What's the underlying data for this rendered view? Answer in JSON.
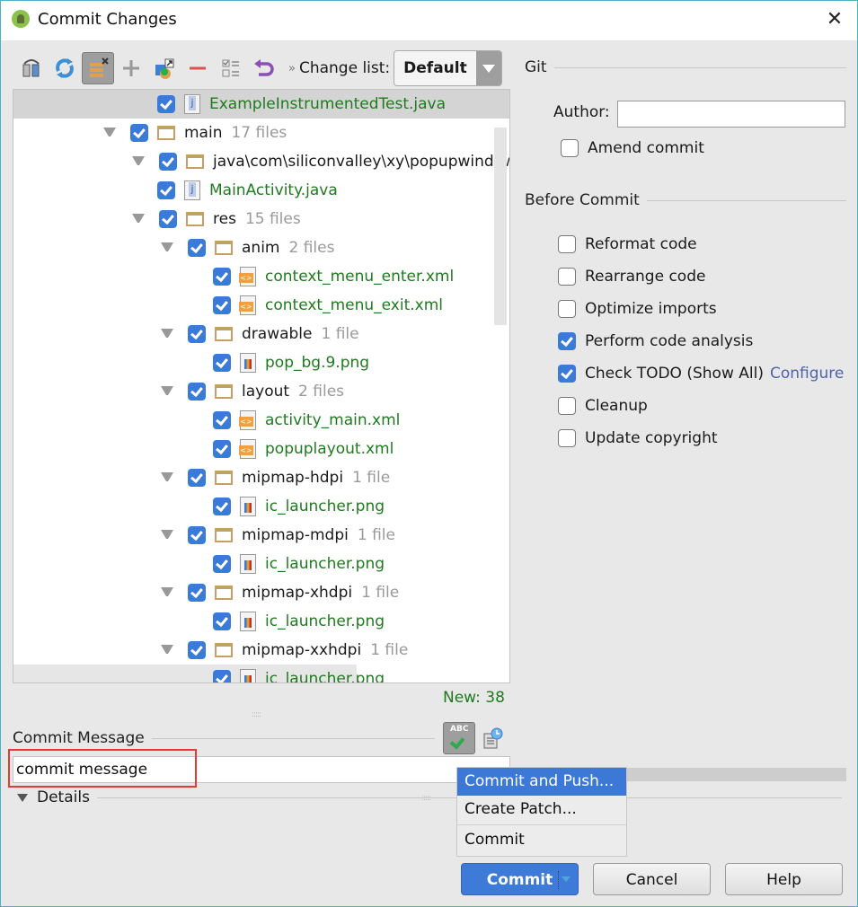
{
  "window": {
    "title": "Commit Changes"
  },
  "toolbar": {
    "buttons": [
      {
        "icon": "show-diff-icon"
      },
      {
        "icon": "refresh-icon"
      },
      {
        "icon": "group-by-icon",
        "active": true
      },
      {
        "icon": "add-icon"
      },
      {
        "icon": "move-to-changelist-icon"
      },
      {
        "icon": "remove-icon"
      },
      {
        "icon": "select-all-icon"
      },
      {
        "icon": "revert-icon"
      }
    ],
    "changelist_label": "Change list:",
    "changelist_value": "Default"
  },
  "tree": {
    "rows": [
      {
        "type": "file",
        "kind": "java",
        "name": "ExampleInstrumentedTest.java",
        "level": 3,
        "checked": true,
        "selected": true
      },
      {
        "type": "folder",
        "name": "main",
        "count": "17 files",
        "level": 1,
        "checked": true
      },
      {
        "type": "folder",
        "name": "java\\com\\siliconvalley\\xy\\popupwindow",
        "count": "",
        "level": 2,
        "checked": true
      },
      {
        "type": "file",
        "kind": "java",
        "name": "MainActivity.java",
        "level": 3,
        "checked": true
      },
      {
        "type": "folder",
        "name": "res",
        "count": "15 files",
        "level": 2,
        "checked": true
      },
      {
        "type": "folder",
        "name": "anim",
        "count": "2 files",
        "level": 3,
        "checked": true
      },
      {
        "type": "file",
        "kind": "xml",
        "name": "context_menu_enter.xml",
        "level": 4,
        "checked": true
      },
      {
        "type": "file",
        "kind": "xml",
        "name": "context_menu_exit.xml",
        "level": 4,
        "checked": true
      },
      {
        "type": "folder",
        "name": "drawable",
        "count": "1 file",
        "level": 3,
        "checked": true
      },
      {
        "type": "file",
        "kind": "png",
        "name": "pop_bg.9.png",
        "level": 4,
        "checked": true
      },
      {
        "type": "folder",
        "name": "layout",
        "count": "2 files",
        "level": 3,
        "checked": true
      },
      {
        "type": "file",
        "kind": "xml",
        "name": "activity_main.xml",
        "level": 4,
        "checked": true
      },
      {
        "type": "file",
        "kind": "xml",
        "name": "popuplayout.xml",
        "level": 4,
        "checked": true
      },
      {
        "type": "folder",
        "name": "mipmap-hdpi",
        "count": "1 file",
        "level": 3,
        "checked": true
      },
      {
        "type": "file",
        "kind": "png",
        "name": "ic_launcher.png",
        "level": 4,
        "checked": true
      },
      {
        "type": "folder",
        "name": "mipmap-mdpi",
        "count": "1 file",
        "level": 3,
        "checked": true
      },
      {
        "type": "file",
        "kind": "png",
        "name": "ic_launcher.png",
        "level": 4,
        "checked": true
      },
      {
        "type": "folder",
        "name": "mipmap-xhdpi",
        "count": "1 file",
        "level": 3,
        "checked": true
      },
      {
        "type": "file",
        "kind": "png",
        "name": "ic_launcher.png",
        "level": 4,
        "checked": true
      },
      {
        "type": "folder",
        "name": "mipmap-xxhdpi",
        "count": "1 file",
        "level": 3,
        "checked": true
      },
      {
        "type": "file",
        "kind": "png",
        "name": "ic_launcher.png",
        "level": 4,
        "checked": true,
        "partial": true
      }
    ],
    "status": "New: 38"
  },
  "commit_message": {
    "label": "Commit Message",
    "value": "commit message",
    "spellcheck_icon": "spellcheck-icon",
    "history_icon": "message-history-icon"
  },
  "details": {
    "label": "Details"
  },
  "git": {
    "title": "Git",
    "author_label": "Author:",
    "author_value": "",
    "amend_label": "Amend commit",
    "amend_checked": false
  },
  "before_commit": {
    "title": "Before Commit",
    "options": [
      {
        "label": "Reformat code",
        "checked": false
      },
      {
        "label": "Rearrange code",
        "checked": false
      },
      {
        "label": "Optimize imports",
        "checked": false
      },
      {
        "label": "Perform code analysis",
        "checked": true
      },
      {
        "label": "Check TODO (Show All)",
        "checked": true,
        "link": "Configure"
      },
      {
        "label": "Cleanup",
        "checked": false
      },
      {
        "label": "Update copyright",
        "checked": false
      }
    ]
  },
  "commit_menu": {
    "items": [
      {
        "label": "Commit and Push...",
        "active": true
      },
      {
        "label": "Create Patch...",
        "active": false
      },
      {
        "label": "Commit",
        "active": false
      }
    ]
  },
  "buttons": {
    "commit": "Commit",
    "cancel": "Cancel",
    "help": "Help"
  },
  "colors": {
    "accent": "#3c79d6",
    "new_file_green": "#1f7a1f",
    "highlight_red": "#e53935",
    "link": "#4e63a8"
  }
}
